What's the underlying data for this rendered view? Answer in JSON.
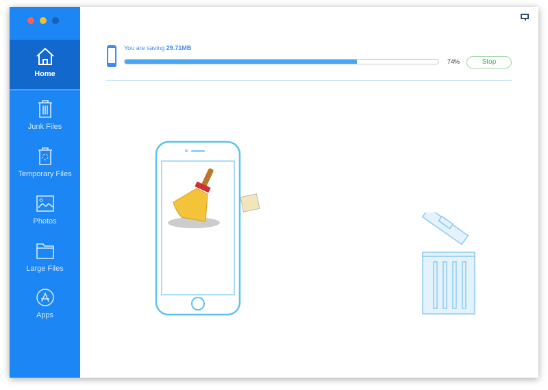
{
  "window": {
    "controls": [
      "close",
      "minimize",
      "zoom"
    ]
  },
  "sidebar": {
    "items": [
      {
        "label": "Home",
        "icon": "home-icon",
        "active": true
      },
      {
        "label": "Junk Files",
        "icon": "trash-icon"
      },
      {
        "label": "Temporary Files",
        "icon": "recycle-bin-icon"
      },
      {
        "label": "Photos",
        "icon": "photo-icon"
      },
      {
        "label": "Large Files",
        "icon": "folder-icon"
      },
      {
        "label": "Apps",
        "icon": "app-store-icon"
      }
    ]
  },
  "progress": {
    "prefix": "You are saving ",
    "amount": "29.71MB",
    "percent_label": "74%",
    "percent": 74,
    "stop_label": "Stop"
  },
  "colors": {
    "sidebar": "#1b86f4",
    "active": "#1268cc",
    "progress": "#48a6f5",
    "stop": "#4aaa55"
  }
}
